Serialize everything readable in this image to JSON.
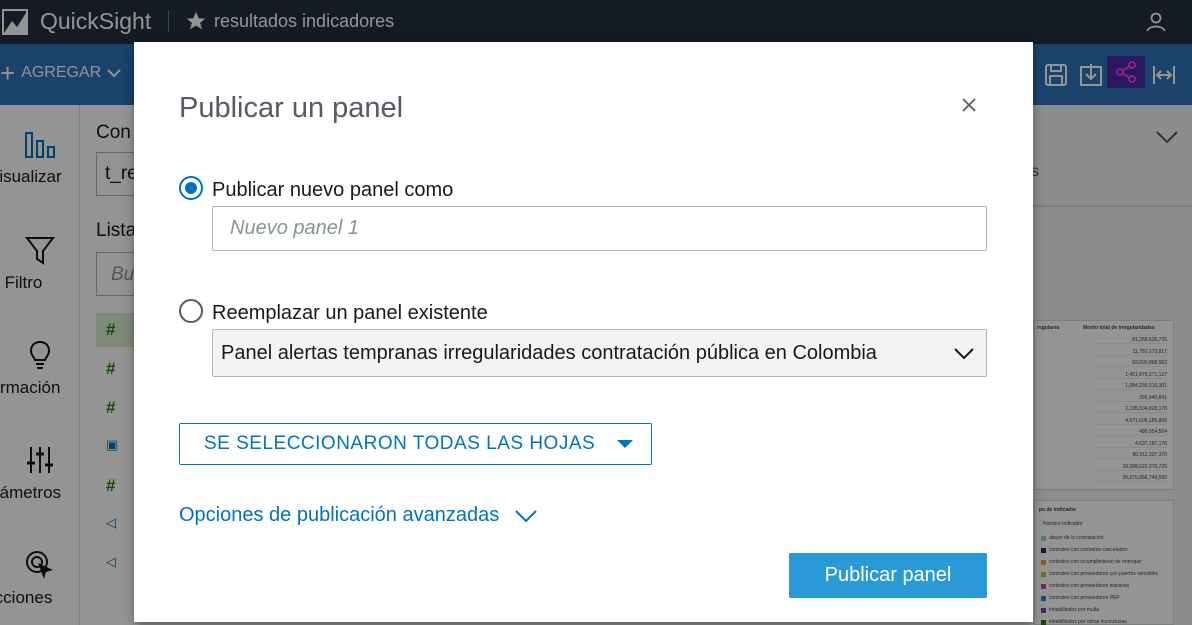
{
  "app": {
    "name": "QuickSight",
    "analysis_title": "resultados indicadores"
  },
  "toolbar": {
    "add_label": "AGREGAR"
  },
  "leftnav": {
    "items": [
      {
        "label": "isualizar",
        "icon": "bar-chart-icon"
      },
      {
        "label": "Filtro",
        "icon": "filter-icon"
      },
      {
        "label": "ormación",
        "icon": "lightbulb-icon"
      },
      {
        "label": "rámetros",
        "icon": "sliders-icon"
      },
      {
        "label": "cciones",
        "icon": "cursor-click-icon"
      }
    ]
  },
  "fieldpanel": {
    "con_label": "Con",
    "dataset_value": "t_re",
    "list_label": "Lista",
    "search_placeholder": "Bu"
  },
  "rightpanel": {
    "table_header_1": "regulares",
    "table_header_2": "Monto total de irregularidades",
    "table_values": [
      "81,258,635,735",
      "11,762,172,817",
      "83,000,808,552",
      "1,451,875,371,127",
      "1,084,236,016,301",
      "285,440,841",
      "2,135,504,828,178",
      "4,571,605,185,806",
      "485,054,504",
      "4,637,187,176",
      "80,911,307,370",
      "29,588,622,370,725",
      "36,675,866,749,560"
    ],
    "legend_title": "po de indicador",
    "legend_subtitle": "Nombre Indicador",
    "legend_items": [
      {
        "label": "abuso de la contratación",
        "color": "#8fd0e0"
      },
      {
        "label": "contratos con contratos cancelados",
        "color": "#1f3864"
      },
      {
        "label": "contratos con incumplimiento de entregas",
        "color": "#f0a030"
      },
      {
        "label": "contratos con proveedores con puertos sensibles",
        "color": "#a7c73a"
      },
      {
        "label": "contratos con proveedores inactivos",
        "color": "#d9409a"
      },
      {
        "label": "contratos con proveedores PEP",
        "color": "#3a7ad9"
      },
      {
        "label": "inhabilitados por multa",
        "color": "#7b3fc4"
      },
      {
        "label": "inhabilitados por obras inconclusas",
        "color": "#1d8102"
      }
    ]
  },
  "modal": {
    "title": "Publicar un panel",
    "option_new_label": "Publicar nuevo panel como",
    "new_panel_placeholder": "Nuevo panel 1",
    "new_panel_value": "",
    "option_replace_label": "Reemplazar un panel existente",
    "existing_panel_selected": "Panel alertas tempranas irregularidades contratación pública en Colombia",
    "sheets_button_label": "SE SELECCIONARON TODAS LAS HOJAS",
    "advanced_options_label": "Opciones de publicación avanzadas",
    "publish_button_label": "Publicar panel",
    "selected_option": "new"
  },
  "colors": {
    "topbar": "#232f3e",
    "toolbar": "#2e73b8",
    "accent": "#0073bb",
    "primary_button": "#2a9ad6"
  }
}
